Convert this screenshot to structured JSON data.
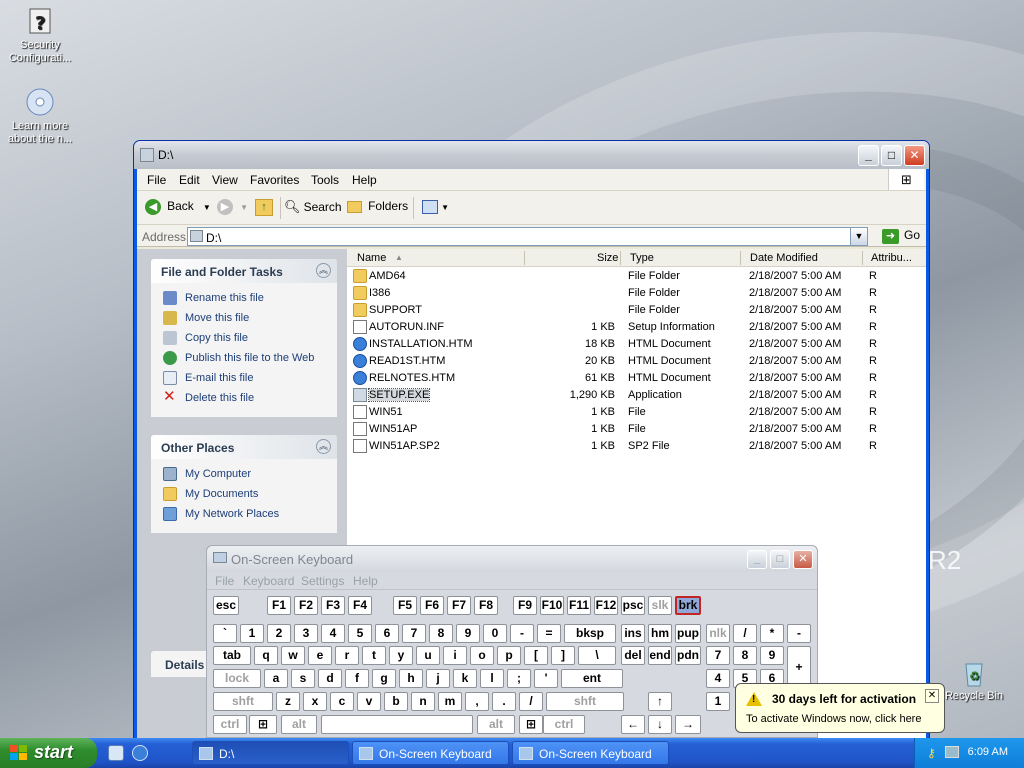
{
  "desktop": {
    "icons": [
      {
        "label": "Security Configurati..."
      },
      {
        "label": "Learn more about the n..."
      },
      {
        "label": "Recycle Bin"
      }
    ],
    "watermark": "R2"
  },
  "explorer": {
    "title": "D:\\",
    "menu": [
      "File",
      "Edit",
      "View",
      "Favorites",
      "Tools",
      "Help"
    ],
    "toolbar": {
      "back": "Back",
      "search": "Search",
      "folders": "Folders"
    },
    "address": {
      "label": "Address",
      "value": "D:\\",
      "go": "Go"
    },
    "file_tasks": {
      "title": "File and Folder Tasks",
      "items": [
        "Rename this file",
        "Move this file",
        "Copy this file",
        "Publish this file to the Web",
        "E-mail this file",
        "Delete this file"
      ]
    },
    "other_places": {
      "title": "Other Places",
      "items": [
        "My Computer",
        "My Documents",
        "My Network Places"
      ]
    },
    "details_label": "Details",
    "columns": {
      "name": "Name",
      "size": "Size",
      "type": "Type",
      "date": "Date Modified",
      "attr": "Attribu..."
    },
    "files": [
      {
        "name": "AMD64",
        "size": "",
        "type": "File Folder",
        "date": "2/18/2007 5:00 AM",
        "attr": "R",
        "icon": "folder"
      },
      {
        "name": "I386",
        "size": "",
        "type": "File Folder",
        "date": "2/18/2007 5:00 AM",
        "attr": "R",
        "icon": "folder"
      },
      {
        "name": "SUPPORT",
        "size": "",
        "type": "File Folder",
        "date": "2/18/2007 5:00 AM",
        "attr": "R",
        "icon": "folder"
      },
      {
        "name": "AUTORUN.INF",
        "size": "1 KB",
        "type": "Setup Information",
        "date": "2/18/2007 5:00 AM",
        "attr": "R",
        "icon": "doc"
      },
      {
        "name": "INSTALLATION.HTM",
        "size": "18 KB",
        "type": "HTML Document",
        "date": "2/18/2007 5:00 AM",
        "attr": "R",
        "icon": "ie"
      },
      {
        "name": "READ1ST.HTM",
        "size": "20 KB",
        "type": "HTML Document",
        "date": "2/18/2007 5:00 AM",
        "attr": "R",
        "icon": "ie"
      },
      {
        "name": "RELNOTES.HTM",
        "size": "61 KB",
        "type": "HTML Document",
        "date": "2/18/2007 5:00 AM",
        "attr": "R",
        "icon": "ie"
      },
      {
        "name": "SETUP.EXE",
        "size": "1,290 KB",
        "type": "Application",
        "date": "2/18/2007 5:00 AM",
        "attr": "R",
        "icon": "exe",
        "selected": true
      },
      {
        "name": "WIN51",
        "size": "1 KB",
        "type": "File",
        "date": "2/18/2007 5:00 AM",
        "attr": "R",
        "icon": "doc"
      },
      {
        "name": "WIN51AP",
        "size": "1 KB",
        "type": "File",
        "date": "2/18/2007 5:00 AM",
        "attr": "R",
        "icon": "doc"
      },
      {
        "name": "WIN51AP.SP2",
        "size": "1 KB",
        "type": "SP2 File",
        "date": "2/18/2007 5:00 AM",
        "attr": "R",
        "icon": "doc"
      }
    ]
  },
  "osk": {
    "title": "On-Screen Keyboard",
    "menu": [
      "File",
      "Keyboard",
      "Settings",
      "Help"
    ],
    "rows": [
      [
        "esc",
        "F1",
        "F2",
        "F3",
        "F4",
        "F5",
        "F6",
        "F7",
        "F8",
        "F9",
        "F10",
        "F11",
        "F12",
        "psc",
        "slk",
        "brk"
      ],
      [
        "`",
        "1",
        "2",
        "3",
        "4",
        "5",
        "6",
        "7",
        "8",
        "9",
        "0",
        "-",
        "=",
        "bksp",
        "ins",
        "hm",
        "pup",
        "nlk",
        "/",
        "*",
        "-"
      ],
      [
        "tab",
        "q",
        "w",
        "e",
        "r",
        "t",
        "y",
        "u",
        "i",
        "o",
        "p",
        "[",
        "]",
        "\\",
        "del",
        "end",
        "pdn",
        "7",
        "8",
        "9",
        "+"
      ],
      [
        "lock",
        "a",
        "s",
        "d",
        "f",
        "g",
        "h",
        "j",
        "k",
        "l",
        ";",
        "'",
        "ent",
        "4",
        "5",
        "6"
      ],
      [
        "shft",
        "z",
        "x",
        "c",
        "v",
        "b",
        "n",
        "m",
        ",",
        ".",
        "/",
        "shft",
        "1"
      ],
      [
        "ctrl",
        "alt",
        "alt",
        "ctrl"
      ]
    ]
  },
  "balloon": {
    "title": "30 days left for activation",
    "text": "To activate Windows now, click here"
  },
  "taskbar": {
    "start": "start",
    "tasks": [
      "D:\\",
      "On-Screen Keyboard",
      "On-Screen Keyboard"
    ],
    "clock": "6:09 AM"
  },
  "colors": {
    "selection": "#d5d9de",
    "taskbar": "#2560d6",
    "start": "#2f8d2c",
    "balloon": "#ffffe1"
  }
}
